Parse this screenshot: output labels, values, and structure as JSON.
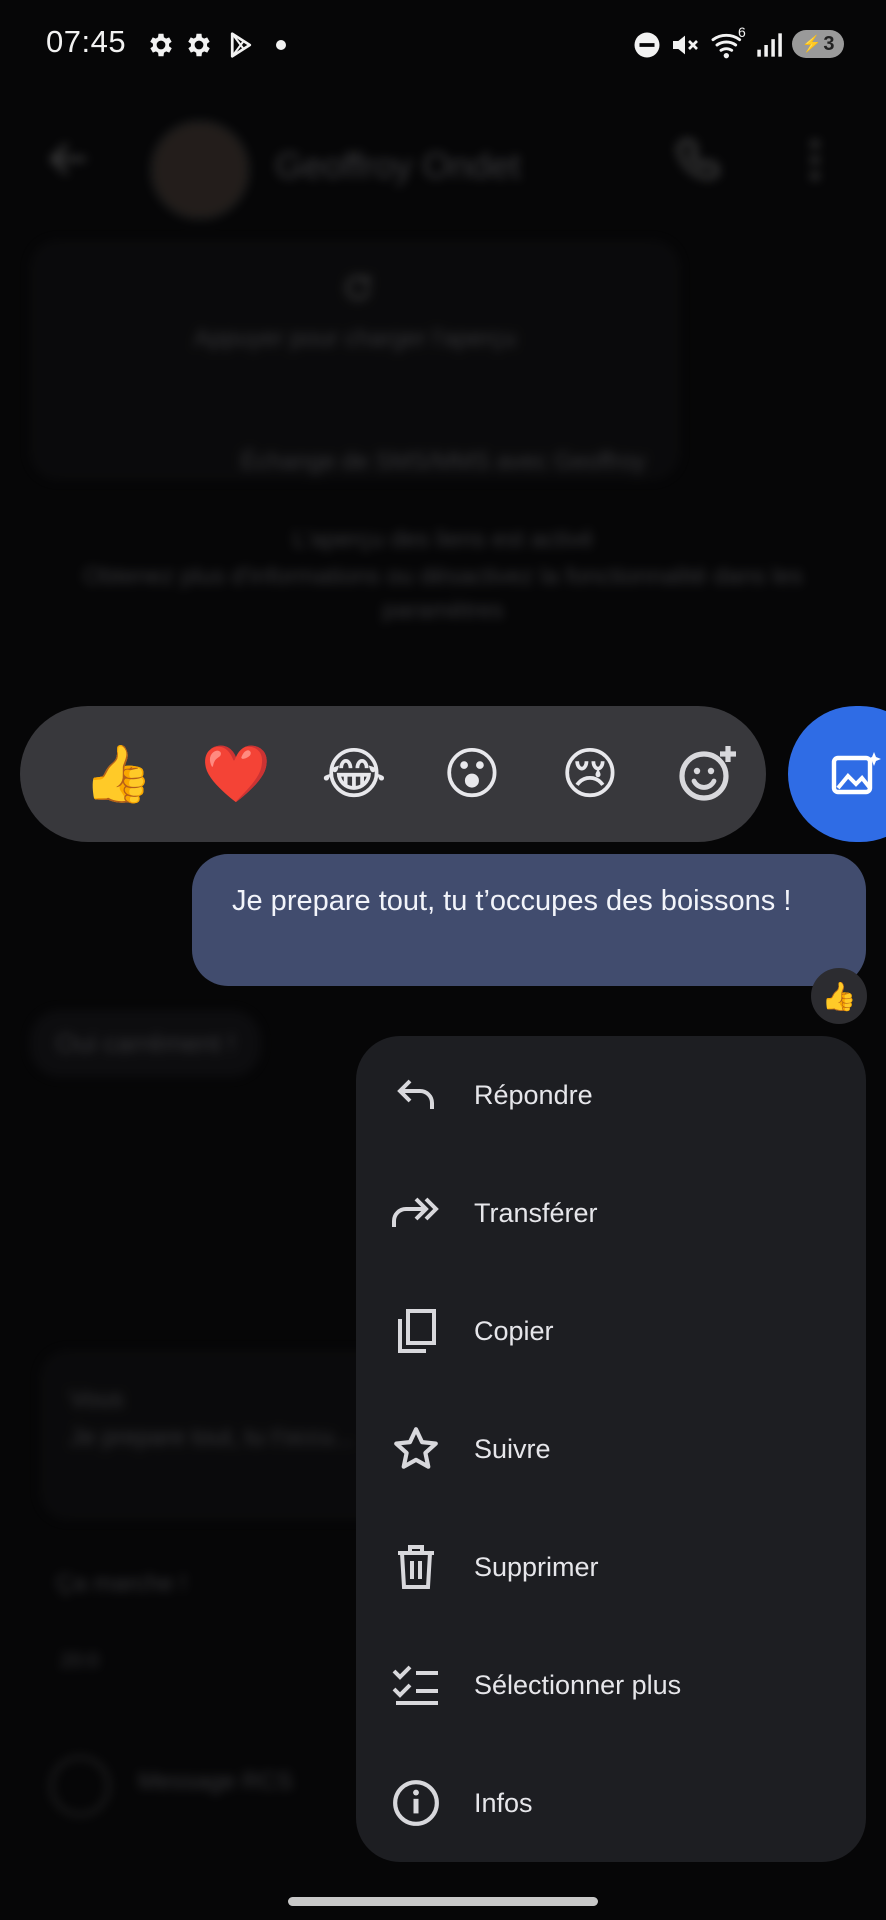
{
  "status_bar": {
    "time": "07:45",
    "left_icons": [
      "gear-icon",
      "gear-icon",
      "play-store-icon",
      "dot-icon"
    ],
    "right_icons": [
      "do-not-disturb-icon",
      "mute-icon",
      "wifi-icon",
      "signal-icon"
    ],
    "wifi_badge": "6",
    "battery_level": "3"
  },
  "background": {
    "contact_name": "Geoffroy Ondet",
    "preview_hint": "Appuyer pour charger l'aperçu",
    "rcs_notice": "Échange de SMS/MMS avec Geoffroy",
    "link_notice_1": "L'aperçu des liens est activé",
    "link_notice_2": "Obtenez plus d'informations ou désactivez la fonctionnalité dans les paramètres",
    "incoming_message": "Oui carrément !",
    "quote_sender": "Vous",
    "quote_text": "Je prepare tout, tu t'occu...",
    "reply_text": "Ça marche !",
    "reply_time": "20:0",
    "compose_placeholder": "Message RCS"
  },
  "reactions": [
    {
      "emoji": "👍",
      "name": "thumbs-up"
    },
    {
      "emoji": "❤️",
      "name": "heart"
    },
    {
      "emoji": "😂",
      "name": "laughing"
    },
    {
      "emoji": "😮",
      "name": "surprised"
    },
    {
      "emoji": "😢",
      "name": "sad"
    }
  ],
  "selected_message": {
    "text": "Je prepare tout, tu t’occupes des boissons !",
    "reaction": "👍"
  },
  "menu": {
    "items": [
      {
        "label": "Répondre",
        "icon": "reply-icon"
      },
      {
        "label": "Transférer",
        "icon": "forward-icon"
      },
      {
        "label": "Copier",
        "icon": "copy-icon"
      },
      {
        "label": "Suivre",
        "icon": "star-icon"
      },
      {
        "label": "Supprimer",
        "icon": "trash-icon"
      },
      {
        "label": "Sélectionner plus",
        "icon": "select-more-icon"
      },
      {
        "label": "Infos",
        "icon": "info-icon"
      }
    ]
  },
  "colors": {
    "bubble": "#414c6e",
    "menu_bg": "#1d1e22",
    "reaction_bar": "#38383c",
    "accent_fab": "#2f6ce5"
  }
}
